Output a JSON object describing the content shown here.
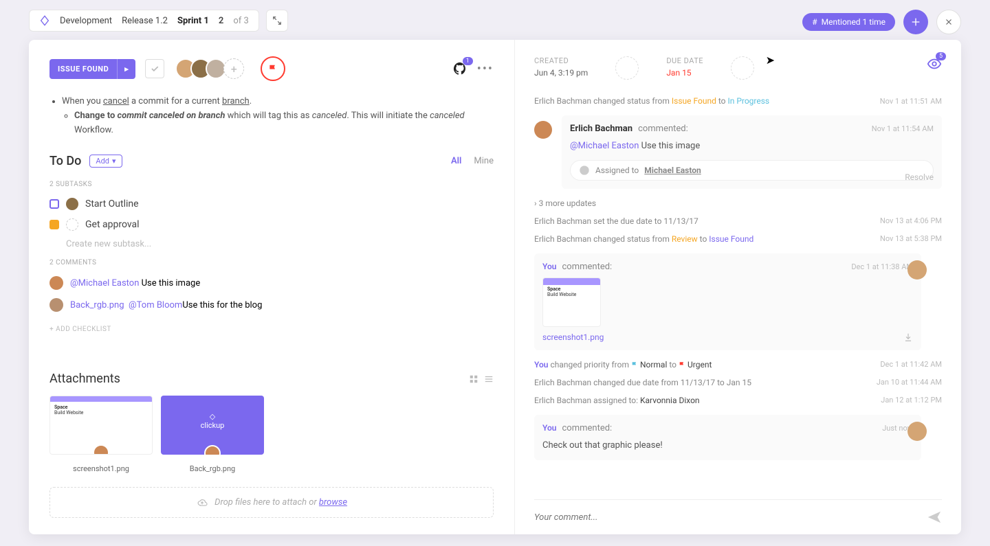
{
  "breadcrumb": {
    "space": "Development",
    "release": "Release 1.2",
    "sprint": "Sprint 1",
    "index": "2",
    "of": "of 3"
  },
  "header": {
    "mention": "Mentioned 1 time"
  },
  "task": {
    "status": "ISSUE FOUND",
    "gh_count": "1",
    "desc_line1_a": "When you ",
    "desc_line1_b": "cancel",
    "desc_line1_c": " a commit for a current ",
    "desc_line1_d": "branch",
    "desc_line2_a": "Change to ",
    "desc_line2_b": "commit canceled on branch",
    "desc_line2_c": " which will tag this as ",
    "desc_line2_d": "canceled",
    "desc_line2_e": ". This will initiate the ",
    "desc_line2_f": "canceled",
    "desc_line2_g": " Workflow."
  },
  "todo": {
    "title": "To Do",
    "add": "Add",
    "tab_all": "All",
    "tab_mine": "Mine",
    "sub_count": "2 SUBTASKS",
    "t1": "Start Outline",
    "t2": "Get approval",
    "new": "Create new subtask...",
    "com_count": "2 COMMENTS",
    "c1_mention": "@Michael Easton",
    "c1_text": " Use this image",
    "c2_file": "Back_rgb.png",
    "c2_mention": "@Tom Bloom",
    "c2_text": "Use this for the blog",
    "add_chk": "+ ADD CHECKLIST"
  },
  "attachments": {
    "title": "Attachments",
    "f1": "screenshot1.png",
    "f2": "Back_rgb.png",
    "drop_a": "Drop files here to attach or ",
    "drop_b": "browse"
  },
  "meta": {
    "created_lbl": "CREATED",
    "created_val": "Jun 4, 3:19 pm",
    "due_lbl": "DUE DATE",
    "due_val": "Jan 15",
    "watchers": "5"
  },
  "activity": {
    "a1_user": "Erlich Bachman",
    "a1_text": " changed status from ",
    "a1_from": "Issue Found",
    "a1_to_lbl": " to ",
    "a1_to": "In Progress",
    "a1_time": "Nov 1 at 11:51 AM",
    "c1_name": "Erlich Bachman",
    "c1_verb": "commented:",
    "c1_time": "Nov 1 at 11:54 AM",
    "c1_mention": "@Michael Easton",
    "c1_text": " Use this image",
    "c1_assigned_lbl": "Assigned to",
    "c1_assigned_name": "Michael Easton",
    "c1_resolve": "Resolve",
    "more": "3 more updates",
    "a2": "Erlich Bachman set the due date to 11/13/17",
    "a2_time": "Nov 13 at 4:06 PM",
    "a3_user": "Erlich Bachman",
    "a3_text": " changed status from ",
    "a3_from": "Review",
    "a3_to": "Issue Found",
    "a3_time": "Nov 13 at 5:38 PM",
    "c2_you": "You",
    "c2_verb": " commented:",
    "c2_time": "Dec 1 at 11:38 AM",
    "c2_img": "screenshot1.png",
    "a4_you": "You",
    "a4_text": " changed priority from ",
    "a4_from": "Normal",
    "a4_to": "Urgent",
    "a4_time": "Dec 1 at 11:42 AM",
    "a5": "Erlich Bachman changed due date from 11/13/17 to Jan 15",
    "a5_time": "Jan 10 at 11:44 AM",
    "a6_a": "Erlich Bachman assigned to: ",
    "a6_b": "Karvonnia Dixon",
    "a6_time": "Jan 12 at 1:12 PM",
    "c3_you": "You",
    "c3_verb": " commented:",
    "c3_time": "Just now",
    "c3_body": "Check out that graphic please!",
    "input_ph": "Your comment..."
  }
}
